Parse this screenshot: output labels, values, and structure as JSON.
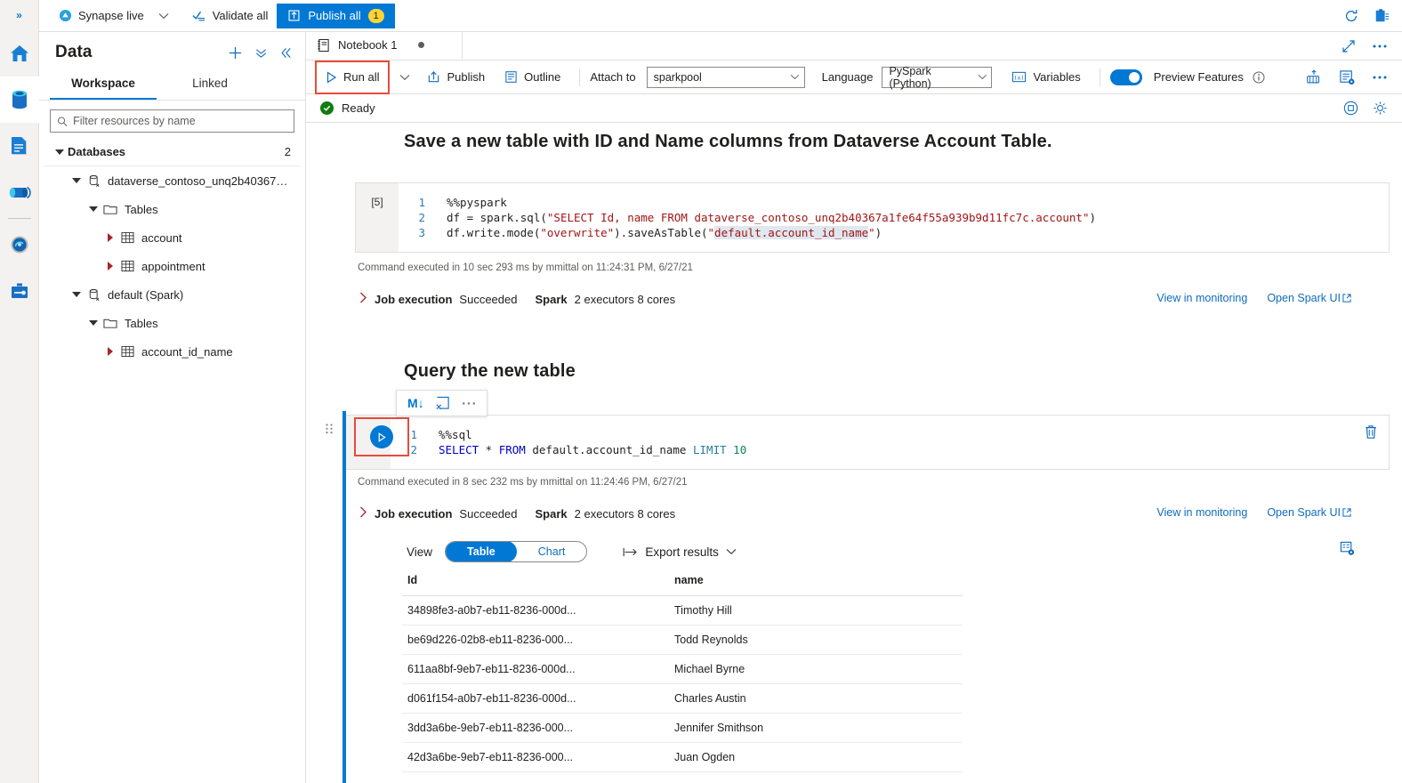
{
  "rail": {
    "expand_label": "»",
    "items": [
      {
        "name": "home",
        "label": "Home"
      },
      {
        "name": "data",
        "label": "Data"
      },
      {
        "name": "develop",
        "label": "Develop"
      },
      {
        "name": "integrate",
        "label": "Integrate"
      },
      {
        "name": "monitor",
        "label": "Monitor"
      },
      {
        "name": "manage",
        "label": "Manage"
      }
    ]
  },
  "ribbon": {
    "mode_label": "Synapse live",
    "validate_label": "Validate all",
    "publish_label": "Publish all",
    "publish_count": "1",
    "refresh_icon": "refresh-icon",
    "feedback_icon": "feedback-icon"
  },
  "sidebar": {
    "title": "Data",
    "add_icon": "plus-icon",
    "collapse_all_icon": "double-chevron-down-icon",
    "collapse_icon": "double-chevron-left-icon",
    "tabs": [
      {
        "label": "Workspace",
        "selected": true
      },
      {
        "label": "Linked",
        "selected": false
      }
    ],
    "filter_placeholder": "Filter resources by name",
    "filter_value": "",
    "tree": [
      {
        "label": "Databases",
        "count": "2",
        "indent": 0,
        "expanded": true,
        "icon": "none",
        "kind": "header"
      },
      {
        "label": "dataverse_contoso_unq2b40367a1f...",
        "indent": 1,
        "expanded": true,
        "icon": "database-icon",
        "kind": "db"
      },
      {
        "label": "Tables",
        "indent": 2,
        "expanded": true,
        "icon": "folder-icon",
        "kind": "folder"
      },
      {
        "label": "account",
        "indent": 3,
        "expanded": false,
        "icon": "table-icon",
        "kind": "table"
      },
      {
        "label": "appointment",
        "indent": 3,
        "expanded": false,
        "icon": "table-icon",
        "kind": "table"
      },
      {
        "label": "default (Spark)",
        "indent": 1,
        "expanded": true,
        "icon": "database-icon",
        "kind": "db"
      },
      {
        "label": "Tables",
        "indent": 2,
        "expanded": true,
        "icon": "folder-icon",
        "kind": "folder"
      },
      {
        "label": "account_id_name",
        "indent": 3,
        "expanded": false,
        "icon": "table-icon",
        "kind": "table"
      }
    ]
  },
  "notebook": {
    "tab_label": "Notebook 1",
    "tab_icon": "notebook-icon",
    "unsaved_dot": true,
    "expand_icon": "expand-diagonal-icon",
    "more_icon": "ellipsis-icon",
    "toolbar": {
      "run_all_label": "Run all",
      "run_all_icon": "play-icon",
      "run_all_chevron": "chevron-down-icon",
      "publish_label": "Publish",
      "publish_icon": "publish-upload-icon",
      "outline_label": "Outline",
      "outline_icon": "outline-list-icon",
      "attach_to_label": "Attach to",
      "attach_to_value": "sparkpool",
      "language_label": "Language",
      "language_value": "PySpark (Python)",
      "variables_label": "Variables",
      "variables_icon": "variables-xy-icon",
      "preview_features_label": "Preview Features",
      "preview_features_on": true,
      "info_icon": "info-icon",
      "add_to_pipeline_icon": "add-to-pipeline-icon",
      "settings_list_icon": "notebook-settings-icon",
      "more_icon": "ellipsis-icon"
    },
    "status": {
      "text": "Ready",
      "icon": "success-check-icon",
      "stop_icon": "stop-session-icon",
      "gear_icon": "gear-icon"
    }
  },
  "cells": [
    {
      "markdown_heading": "Save a new table with ID and Name columns from Dataverse Account Table.",
      "exec_count": "[5]",
      "code_lines": [
        {
          "n": "1",
          "segments": [
            {
              "t": "%%pyspark",
              "c": "plain"
            }
          ]
        },
        {
          "n": "2",
          "segments": [
            {
              "t": "df = spark.sql(",
              "c": "plain"
            },
            {
              "t": "\"SELECT Id, name FROM dataverse_contoso_unq2b40367a1fe64f55a939b9d11fc7c.account\"",
              "c": "str"
            },
            {
              "t": ")",
              "c": "plain"
            }
          ]
        },
        {
          "n": "3",
          "segments": [
            {
              "t": "df.write.mode(",
              "c": "plain"
            },
            {
              "t": "\"overwrite\"",
              "c": "str"
            },
            {
              "t": ").saveAsTable(",
              "c": "plain"
            },
            {
              "t": "\"",
              "c": "str"
            },
            {
              "t": "default.account_id_name",
              "c": "str-hl"
            },
            {
              "t": "\"",
              "c": "str"
            },
            {
              "t": ")",
              "c": "plain"
            }
          ]
        }
      ],
      "exec_note": "Command executed in 10 sec 293 ms by mmittal on 11:24:31 PM, 6/27/21",
      "job_label": "Job execution",
      "job_status": "Succeeded",
      "spark_label": "Spark",
      "spark_detail": "2 executors 8 cores",
      "view_monitoring": "View in monitoring",
      "open_spark_ui": "Open Spark UI"
    },
    {
      "markdown_heading": "Query the new table",
      "minibar": {
        "markdown_icon": "markdown-convert-icon",
        "markdown_label": "M↓",
        "clear_output_icon": "clear-output-icon",
        "more_icon": "ellipsis-icon"
      },
      "run_icon": "play-circle-icon",
      "delete_icon": "trash-icon",
      "drag_handle_icon": "drag-handle-icon",
      "code_lines": [
        {
          "n": "1",
          "segments": [
            {
              "t": "%%sql",
              "c": "plain"
            }
          ]
        },
        {
          "n": "2",
          "segments": [
            {
              "t": "SELECT",
              "c": "kw"
            },
            {
              "t": " * ",
              "c": "plain"
            },
            {
              "t": "FROM",
              "c": "kw"
            },
            {
              "t": " default.account_id_name ",
              "c": "plain"
            },
            {
              "t": "LIMIT",
              "c": "fn"
            },
            {
              "t": " ",
              "c": "plain"
            },
            {
              "t": "10",
              "c": "num"
            }
          ]
        }
      ],
      "exec_note": "Command executed in 8 sec 232 ms by mmittal on 11:24:46 PM, 6/27/21",
      "job_label": "Job execution",
      "job_status": "Succeeded",
      "spark_label": "Spark",
      "spark_detail": "2 executors 8 cores",
      "view_monitoring": "View in monitoring",
      "open_spark_ui": "Open Spark UI",
      "results": {
        "view_label": "View",
        "pivot": [
          {
            "label": "Table",
            "selected": true
          },
          {
            "label": "Chart",
            "selected": false
          }
        ],
        "export_label": "Export results",
        "export_icon": "export-arrow-icon",
        "export_chevron": "chevron-down-icon",
        "grid_settings_icon": "results-settings-icon",
        "columns": [
          "Id",
          "name"
        ],
        "rows": [
          [
            "34898fe3-a0b7-eb11-8236-000d...",
            "Timothy Hill"
          ],
          [
            "be69d226-02b8-eb11-8236-000...",
            "Todd Reynolds"
          ],
          [
            "611aa8bf-9eb7-eb11-8236-000d...",
            "Michael Byrne"
          ],
          [
            "d061f154-a0b7-eb11-8236-000d...",
            "Charles Austin"
          ],
          [
            "3dd3a6be-9eb7-eb11-8236-000...",
            "Jennifer Smithson"
          ],
          [
            "42d3a6be-9eb7-eb11-8236-000...",
            "Juan Ogden"
          ]
        ]
      }
    }
  ],
  "colors": {
    "accent": "#0078d4",
    "highlight_box": "#e74c3c",
    "badge": "#ffd335",
    "success": "#107c10",
    "link": "#0f6cbd"
  }
}
